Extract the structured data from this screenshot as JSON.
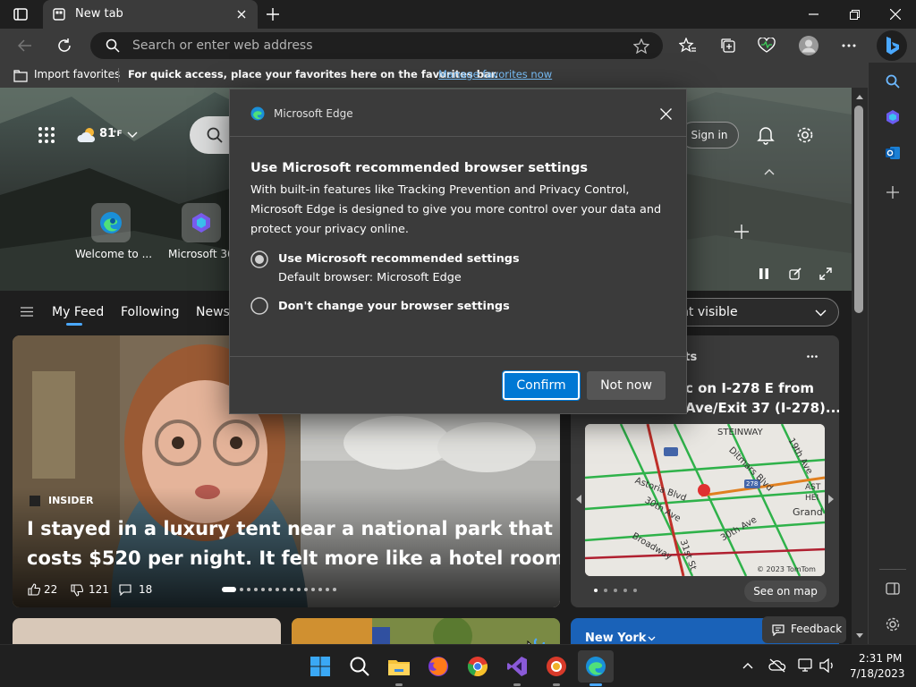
{
  "tab": {
    "title": "New tab"
  },
  "address": {
    "placeholder": "Search or enter web address"
  },
  "favorites_bar": {
    "import_label": "Import favorites",
    "hint": "For quick access, place your favorites here on the favorites bar.",
    "manage_link": "Manage favorites now"
  },
  "newtab": {
    "weather": "81",
    "weather_unit": "°F",
    "sign_in": "Sign in",
    "quick_links": [
      {
        "label": "Welcome to ..."
      },
      {
        "label": "Microsoft 365"
      }
    ],
    "feed_tabs": [
      "My Feed",
      "Following",
      "News"
    ],
    "content_dropdown": "nt visible",
    "main_story": {
      "source": "INSIDER",
      "headline_line1": "I stayed in a luxury tent near a national park that",
      "headline_line2": "costs $520 per night. It felt more like a hotel room...",
      "likes": "22",
      "dislikes": "121",
      "comments": "18"
    },
    "traffic_card": {
      "header": "nts",
      "title_line1": "c on I-278 E from",
      "title_line2": "Ave/Exit 37 (I-278)...",
      "map_labels": [
        "STEINWAY",
        "19th Ave",
        "Ditmars Blvd",
        "Astoria Blvd",
        "30th Ave",
        "Broadway",
        "31st St",
        "30th Ave",
        "Grand Cen",
        "AST",
        "HEI",
        "278"
      ],
      "copyright": "© 2023 TomTom",
      "see_on_map": "See on map"
    },
    "weather_card": {
      "city": "New York"
    },
    "feedback": "Feedback"
  },
  "dialog": {
    "app_name": "Microsoft Edge",
    "title": "Use Microsoft recommended browser settings",
    "body_line1": "With built-in features like Tracking Prevention and Privacy Control,",
    "body_line2": "Microsoft Edge is designed to give you more control over your data and",
    "body_line3": "protect your privacy online.",
    "option1_label": "Use Microsoft recommended settings",
    "option1_sub": "Default browser: Microsoft Edge",
    "option2_label": "Don't change your browser settings",
    "selected_option": 1,
    "confirm": "Confirm",
    "not_now": "Not now"
  },
  "taskbar": {
    "time": "2:31 PM",
    "date": "7/18/2023"
  },
  "colors": {
    "accent": "#0078d4",
    "link": "#7cc4ff",
    "taskbar": "#202020"
  }
}
